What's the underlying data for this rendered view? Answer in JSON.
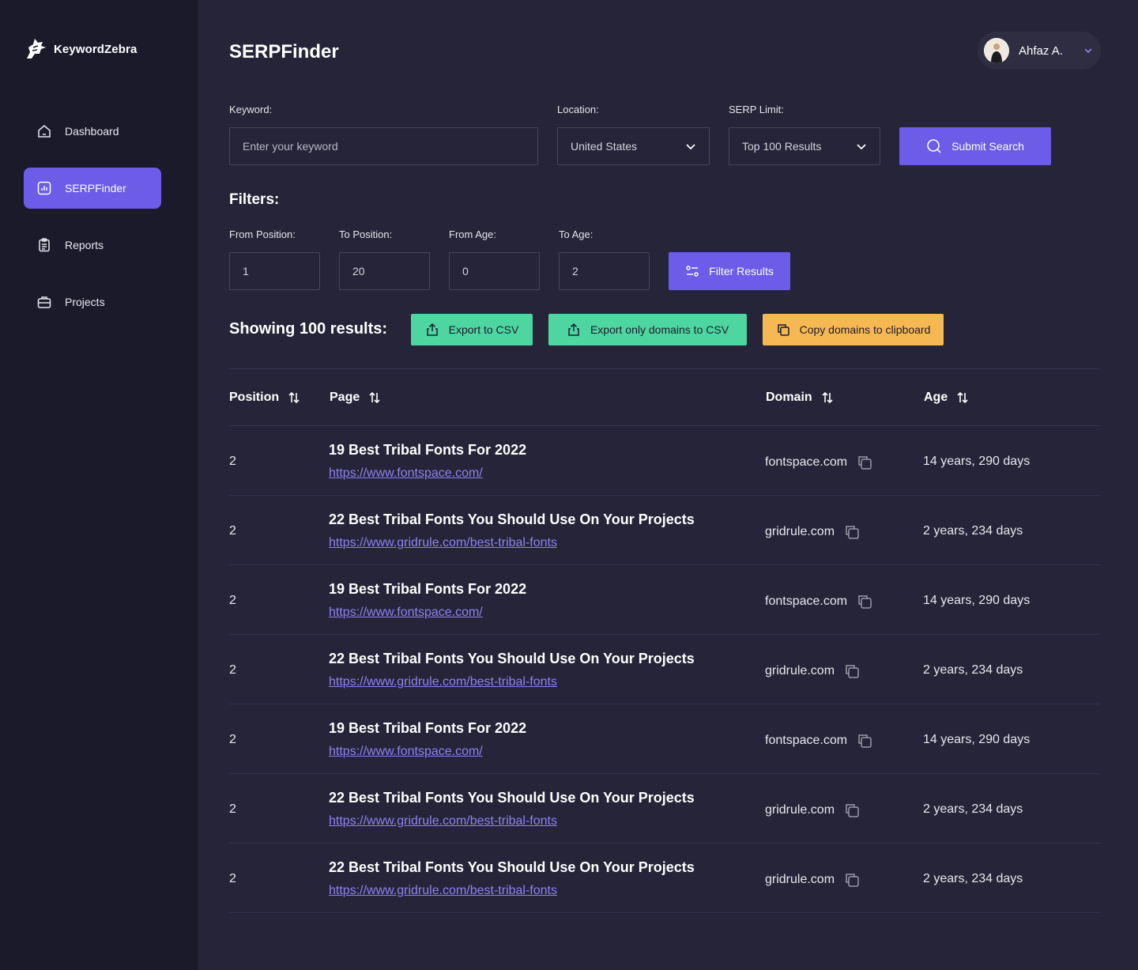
{
  "app": {
    "name": "KeywordZebra"
  },
  "sidebar": {
    "items": [
      {
        "label": "Dashboard",
        "icon": "home-icon",
        "active": false
      },
      {
        "label": "SERPFinder",
        "icon": "chart-icon",
        "active": true
      },
      {
        "label": "Reports",
        "icon": "clipboard-icon",
        "active": false
      },
      {
        "label": "Projects",
        "icon": "briefcase-icon",
        "active": false
      }
    ]
  },
  "header": {
    "title": "SERPFinder",
    "user": {
      "name": "Ahfaz A."
    }
  },
  "search": {
    "keyword_label": "Keyword:",
    "keyword_placeholder": "Enter your keyword",
    "location_label": "Location:",
    "location_value": "United States",
    "limit_label": "SERP Limit:",
    "limit_value": "Top 100 Results",
    "submit_label": "Submit Search"
  },
  "filters": {
    "title": "Filters:",
    "from_position_label": "From Position:",
    "from_position_value": "1",
    "to_position_label": "To Position:",
    "to_position_value": "20",
    "from_age_label": "From Age:",
    "from_age_value": "0",
    "to_age_label": "To Age:",
    "to_age_value": "2",
    "filter_label": "Filter Results"
  },
  "results": {
    "showing_text": "Showing 100 results:",
    "export_csv_label": "Export to CSV",
    "export_domains_label": "Export only domains to CSV",
    "copy_domains_label": "Copy domains to clipboard"
  },
  "table": {
    "columns": {
      "position": "Position",
      "page": "Page",
      "domain": "Domain",
      "age": "Age"
    },
    "rows": [
      {
        "position": "2",
        "title": "19 Best Tribal Fonts For 2022",
        "url": "https://www.fontspace.com/",
        "domain": "fontspace.com",
        "age": "14 years, 290 days"
      },
      {
        "position": "2",
        "title": "22 Best Tribal Fonts You Should Use On Your Projects",
        "url": "https://www.gridrule.com/best-tribal-fonts",
        "domain": "gridrule.com",
        "age": "2 years, 234 days"
      },
      {
        "position": "2",
        "title": "19 Best Tribal Fonts For 2022",
        "url": "https://www.fontspace.com/",
        "domain": "fontspace.com",
        "age": "14 years, 290 days"
      },
      {
        "position": "2",
        "title": "22 Best Tribal Fonts You Should Use On Your Projects",
        "url": "https://www.gridrule.com/best-tribal-fonts",
        "domain": "gridrule.com",
        "age": "2 years, 234 days"
      },
      {
        "position": "2",
        "title": "19 Best Tribal Fonts For 2022",
        "url": "https://www.fontspace.com/",
        "domain": "fontspace.com",
        "age": "14 years, 290 days"
      },
      {
        "position": "2",
        "title": "22 Best Tribal Fonts You Should Use On Your Projects",
        "url": "https://www.gridrule.com/best-tribal-fonts",
        "domain": "gridrule.com",
        "age": "2 years, 234 days"
      },
      {
        "position": "2",
        "title": "22 Best Tribal Fonts You Should Use On Your Projects",
        "url": "https://www.gridrule.com/best-tribal-fonts",
        "domain": "gridrule.com",
        "age": "2 years, 234 days"
      }
    ]
  },
  "colors": {
    "background": "#252438",
    "sidebar": "#1b1a2b",
    "accent": "#6c5ce7",
    "green": "#4ed6a0",
    "yellow": "#f6b852",
    "link": "#8f83f0"
  }
}
